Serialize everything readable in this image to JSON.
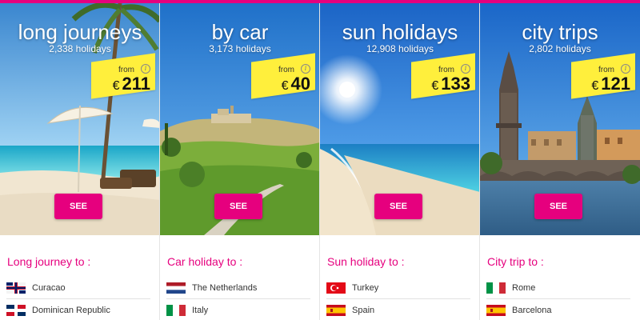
{
  "colors": {
    "accent": "#e6007e",
    "price_tag": "#ffef3c"
  },
  "cards": [
    {
      "title": "long journeys",
      "count": "2,338 holidays",
      "price_from": "from",
      "currency": "€",
      "price": "211",
      "button": "SEE",
      "list_title": "Long journey to :",
      "destinations": [
        {
          "name": "Curacao",
          "flag": "curacao-flag-icon"
        },
        {
          "name": "Dominican Republic",
          "flag": "dominican-republic-flag-icon"
        }
      ]
    },
    {
      "title": "by car",
      "count": "3,173 holidays",
      "price_from": "from",
      "currency": "€",
      "price": "40",
      "button": "SEE",
      "list_title": "Car holiday to :",
      "destinations": [
        {
          "name": "The Netherlands",
          "flag": "netherlands-flag-icon"
        },
        {
          "name": "Italy",
          "flag": "italy-flag-icon"
        }
      ]
    },
    {
      "title": "sun holidays",
      "count": "12,908 holidays",
      "price_from": "from",
      "currency": "€",
      "price": "133",
      "button": "SEE",
      "list_title": "Sun holiday to :",
      "destinations": [
        {
          "name": "Turkey",
          "flag": "turkey-flag-icon"
        },
        {
          "name": "Spain",
          "flag": "spain-flag-icon"
        }
      ]
    },
    {
      "title": "city trips",
      "count": "2,802 holidays",
      "price_from": "from",
      "currency": "€",
      "price": "121",
      "button": "SEE",
      "list_title": "City trip to :",
      "destinations": [
        {
          "name": "Rome",
          "flag": "italy-flag-icon"
        },
        {
          "name": "Barcelona",
          "flag": "spain-flag-icon"
        }
      ]
    }
  ]
}
